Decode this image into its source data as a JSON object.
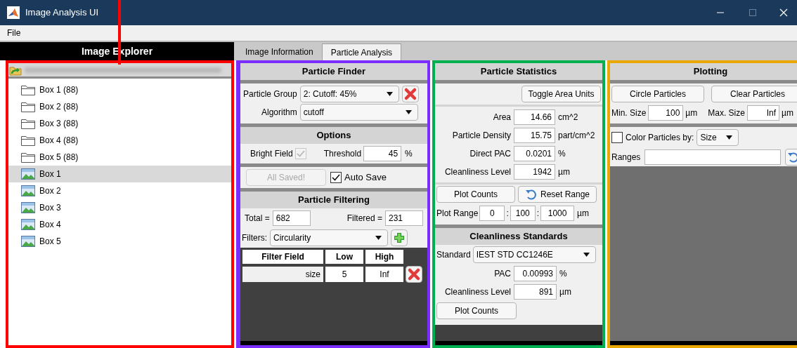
{
  "window": {
    "title": "Image Analysis UI"
  },
  "menu": [
    "File"
  ],
  "highlights": [
    {
      "color": "#ff0000"
    },
    {
      "color": "#7b2cff"
    },
    {
      "color": "#00b050"
    },
    {
      "color": "#e8a800"
    }
  ],
  "explorer": {
    "title": "Image Explorer",
    "tree": [
      {
        "kind": "folder",
        "label": "Box 1 (88)",
        "selected": false
      },
      {
        "kind": "folder",
        "label": "Box 2 (88)",
        "selected": false
      },
      {
        "kind": "folder",
        "label": "Box 3 (88)",
        "selected": false
      },
      {
        "kind": "folder",
        "label": "Box 4 (88)",
        "selected": false
      },
      {
        "kind": "folder",
        "label": "Box 5 (88)",
        "selected": false
      },
      {
        "kind": "image",
        "label": "Box 1",
        "selected": true
      },
      {
        "kind": "image",
        "label": "Box 2",
        "selected": false
      },
      {
        "kind": "image",
        "label": "Box 3",
        "selected": false
      },
      {
        "kind": "image",
        "label": "Box 4",
        "selected": false
      },
      {
        "kind": "image",
        "label": "Box 5",
        "selected": false
      }
    ]
  },
  "tabs": [
    {
      "label": "Image Information",
      "selected": false
    },
    {
      "label": "Particle Analysis",
      "selected": true
    }
  ],
  "finder": {
    "title": "Particle Finder",
    "particle_group": {
      "label": "Particle Group",
      "value": "2: Cutoff: 45%"
    },
    "algorithm": {
      "label": "Algorithm",
      "value": "cutoff"
    },
    "options_title": "Options",
    "bright_field": {
      "label": "Bright Field",
      "checked": true,
      "disabled": true
    },
    "threshold": {
      "label": "Threshold",
      "value": "45",
      "unit": "%"
    },
    "all_saved": {
      "label": "All Saved!",
      "disabled": true
    },
    "auto_save": {
      "label": "Auto Save",
      "checked": true
    },
    "filtering_title": "Particle Filtering",
    "total": {
      "label": "Total =",
      "value": "682"
    },
    "filtered": {
      "label": "Filtered =",
      "value": "231"
    },
    "filters": {
      "label": "Filters:",
      "value": "Circularity"
    },
    "columns": [
      "Filter Field",
      "Low",
      "High"
    ],
    "rows": [
      {
        "field": "size",
        "low": "5",
        "high": "Inf"
      }
    ]
  },
  "statistics": {
    "title": "Particle Statistics",
    "toggle_button": "Toggle Area Units",
    "values": [
      {
        "label": "Area",
        "value": "14.66",
        "unit": "cm^2"
      },
      {
        "label": "Particle Density",
        "value": "15.75",
        "unit": "part/cm^2"
      },
      {
        "label": "Direct PAC",
        "value": "0.0201",
        "unit": "%"
      },
      {
        "label": "Cleanliness Level",
        "value": "1942",
        "unit": "µm"
      }
    ],
    "plot_counts": "Plot Counts",
    "reset_range": "Reset Range",
    "plot_range": {
      "label": "Plot Range",
      "values": [
        "0",
        "100",
        "1000"
      ],
      "separator": ":",
      "unit": "µm"
    },
    "standards_title": "Cleanliness Standards",
    "standard": {
      "label": "Standard",
      "value": "IEST STD CC1246E"
    },
    "standard_values": [
      {
        "label": "PAC",
        "value": "0.00993",
        "unit": "%"
      },
      {
        "label": "Cleanliness Level",
        "value": "891",
        "unit": "µm"
      }
    ],
    "standards_plot_counts": "Plot Counts"
  },
  "plotting": {
    "title": "Plotting",
    "circle_button": "Circle Particles",
    "clear_button": "Clear Particles",
    "min_size": {
      "label": "Min. Size",
      "value": "100",
      "unit": "µm"
    },
    "max_size": {
      "label": "Max. Size",
      "value": "Inf",
      "unit": "µm"
    },
    "color_by": {
      "label": "Color Particles by:",
      "checked": false,
      "value": "Size"
    },
    "ranges": {
      "label": "Ranges"
    }
  }
}
